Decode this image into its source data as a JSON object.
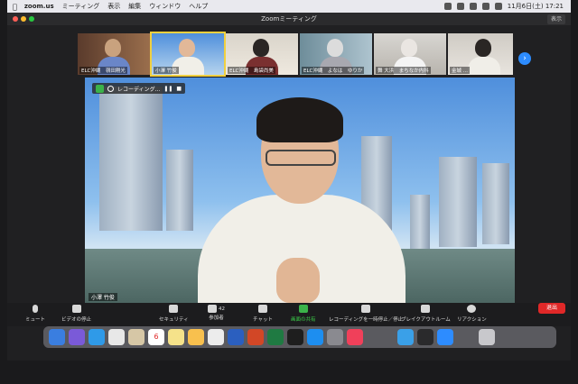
{
  "menubar": {
    "app": "zoom.us",
    "items": [
      "ミーティング",
      "表示",
      "編集",
      "ウィンドウ",
      "ヘルプ"
    ],
    "clock": "11月6日(土) 17:21"
  },
  "window": {
    "title": "Zoomミーティング",
    "view_label": "表示"
  },
  "gallery": [
    {
      "name": "ELC沖縄　嶺田剛光"
    },
    {
      "name": "小澤 竹俊"
    },
    {
      "name": "ELC沖縄　島袋尚美"
    },
    {
      "name": "ELC沖縄　よなは　ゆりか"
    },
    {
      "name": "舞 大浜　まちなか内科"
    },
    {
      "name": "金城 ..."
    }
  ],
  "main_video": {
    "recording_label": "レコーディング...",
    "speaker_name": "小澤 竹俊"
  },
  "toolbar": {
    "mute": "ミュート",
    "video": "ビデオの停止",
    "security": "セキュリティ",
    "participants": "参加者",
    "participants_count": "42",
    "chat": "チャット",
    "share": "画面の共有",
    "recording": "レコーディングを一時停止／停止",
    "breakout": "ブレイクアウトルーム",
    "reaction": "リアクション",
    "end": "退出"
  },
  "dock": {
    "calendar_day": "6"
  },
  "colors": {
    "accent": "#2d8cff",
    "share_green": "#3bb34a",
    "end_red": "#e02828"
  }
}
